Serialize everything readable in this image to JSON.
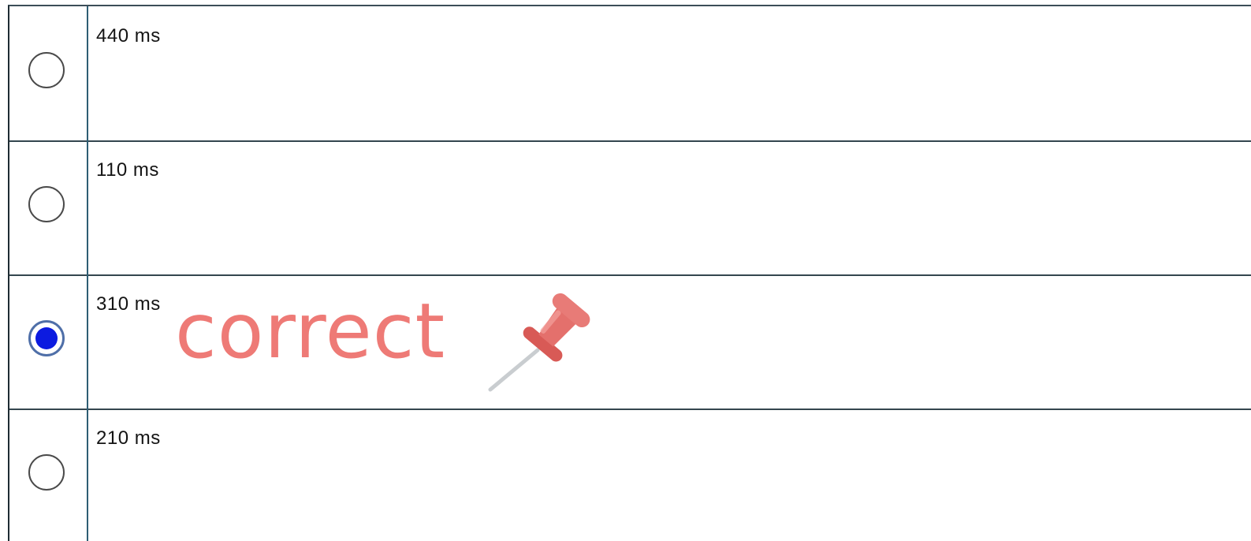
{
  "options": [
    {
      "label": "440 ms",
      "selected": false
    },
    {
      "label": "110 ms",
      "selected": false
    },
    {
      "label": "310 ms",
      "selected": true
    },
    {
      "label": "210 ms",
      "selected": false
    }
  ],
  "annotation": {
    "text": "correct",
    "icon": "pushpin-icon",
    "color": "#ee7a76"
  },
  "colors": {
    "selected_radio": "#0c1be0",
    "row_border": "#34464f"
  }
}
